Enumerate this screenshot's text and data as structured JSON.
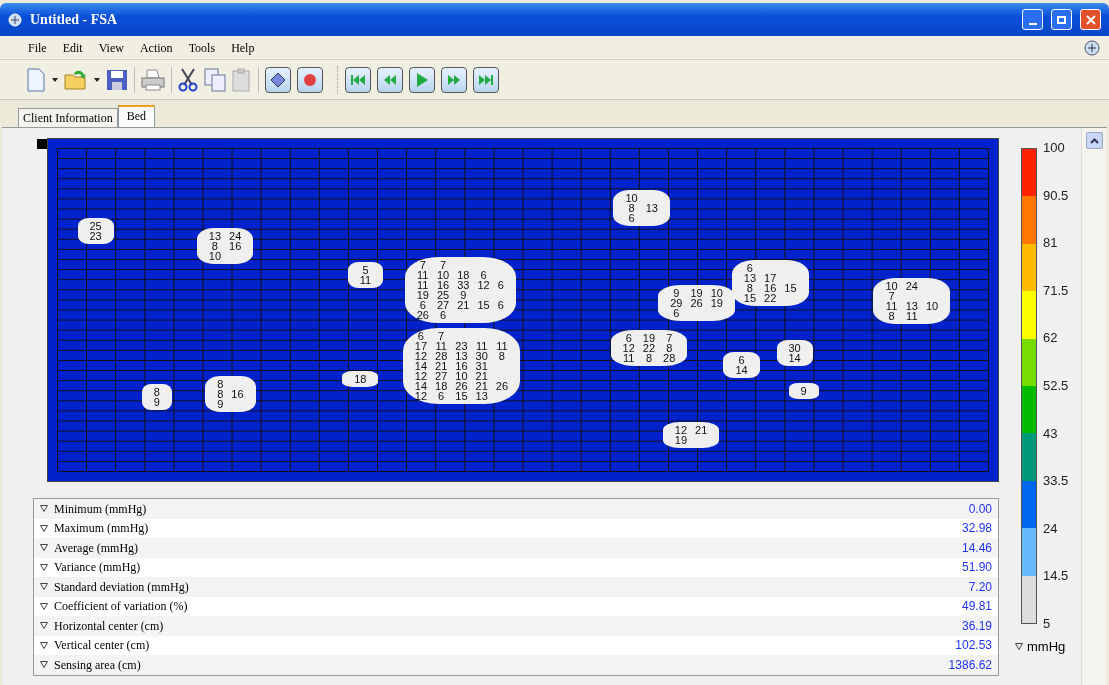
{
  "window": {
    "title": "Untitled - FSA"
  },
  "menu": [
    "File",
    "Edit",
    "View",
    "Action",
    "Tools",
    "Help"
  ],
  "tabs": [
    {
      "label": "Client Information",
      "selected": false
    },
    {
      "label": "Bed",
      "selected": true
    }
  ],
  "map": {
    "blobs": [
      {
        "rows": [
          [
            "25"
          ],
          [
            "23"
          ]
        ]
      },
      {
        "rows": [
          [
            "13",
            "24"
          ],
          [
            "8",
            "16"
          ],
          [
            "10"
          ]
        ]
      },
      {
        "rows": [
          [
            "5"
          ],
          [
            "11"
          ]
        ]
      },
      {
        "rows": [
          [
            "7",
            "7"
          ],
          [
            "11",
            "10",
            "18",
            "6"
          ],
          [
            "11",
            "16",
            "33",
            "12",
            "6"
          ],
          [
            "19",
            "25",
            "9"
          ],
          [
            "6",
            "27",
            "21",
            "15",
            "6"
          ],
          [
            "26",
            "6"
          ]
        ]
      },
      {
        "rows": [
          [
            "6",
            "7"
          ],
          [
            "17",
            "11",
            "23",
            "11",
            "11"
          ],
          [
            "12",
            "28",
            "13",
            "30",
            "8"
          ],
          [
            "14",
            "21",
            "16",
            "31"
          ],
          [
            "12",
            "27",
            "10",
            "21"
          ],
          [
            "14",
            "18",
            "26",
            "21",
            "26"
          ],
          [
            "12",
            "6",
            "15",
            "13"
          ]
        ]
      },
      {
        "rows": [
          [
            "18"
          ]
        ]
      },
      {
        "rows": [
          [
            "8"
          ],
          [
            "9"
          ]
        ]
      },
      {
        "rows": [
          [
            "8"
          ],
          [
            "8",
            "16"
          ],
          [
            "9"
          ]
        ]
      },
      {
        "rows": [
          [
            "10"
          ],
          [
            "8",
            "13"
          ],
          [
            "6"
          ]
        ]
      },
      {
        "rows": [
          [
            "9",
            "19",
            "10"
          ],
          [
            "29",
            "26",
            "19"
          ],
          [
            "6"
          ]
        ]
      },
      {
        "rows": [
          [
            "6"
          ],
          [
            "13",
            "17"
          ],
          [
            "8",
            "16",
            "15"
          ],
          [
            "15",
            "22"
          ]
        ]
      },
      {
        "rows": [
          [
            "6",
            "19",
            "7"
          ],
          [
            "12",
            "22",
            "8"
          ],
          [
            "11",
            "8",
            "28"
          ]
        ]
      },
      {
        "rows": [
          [
            "6"
          ],
          [
            "14"
          ]
        ]
      },
      {
        "rows": [
          [
            "30"
          ],
          [
            "14"
          ]
        ]
      },
      {
        "rows": [
          [
            "9"
          ]
        ]
      },
      {
        "rows": [
          [
            "10",
            "24"
          ],
          [
            "7"
          ],
          [
            "11",
            "13",
            "10"
          ],
          [
            "8",
            "11"
          ]
        ]
      },
      {
        "rows": [
          [
            "12",
            "21"
          ],
          [
            "19"
          ]
        ]
      }
    ]
  },
  "stats": [
    {
      "label": "Minimum (mmHg)",
      "value": "0.00"
    },
    {
      "label": "Maximum (mmHg)",
      "value": "32.98"
    },
    {
      "label": "Average (mmHg)",
      "value": "14.46"
    },
    {
      "label": "Variance (mmHg)",
      "value": "51.90"
    },
    {
      "label": "Standard deviation (mmHg)",
      "value": "7.20"
    },
    {
      "label": "Coefficient of variation (%)",
      "value": "49.81"
    },
    {
      "label": "Horizontal center (cm)",
      "value": "36.19"
    },
    {
      "label": "Vertical center (cm)",
      "value": "102.53"
    },
    {
      "label": "Sensing area (cm)",
      "value": "1386.62"
    }
  ],
  "legend": {
    "ticks": [
      "100",
      "90.5",
      "81",
      "71.5",
      "62",
      "52.5",
      "43",
      "33.5",
      "24",
      "14.5",
      "5"
    ],
    "bands": [
      {
        "color": "#ff2200"
      },
      {
        "color": "#ff7700"
      },
      {
        "color": "#ffbb00"
      },
      {
        "color": "#ffff00"
      },
      {
        "color": "#77dd00"
      },
      {
        "color": "#00bb00"
      },
      {
        "color": "#009977"
      },
      {
        "color": "#0066ee"
      },
      {
        "color": "#66bbff"
      },
      {
        "color": "#dddddd"
      }
    ],
    "unit": "mmHg"
  }
}
